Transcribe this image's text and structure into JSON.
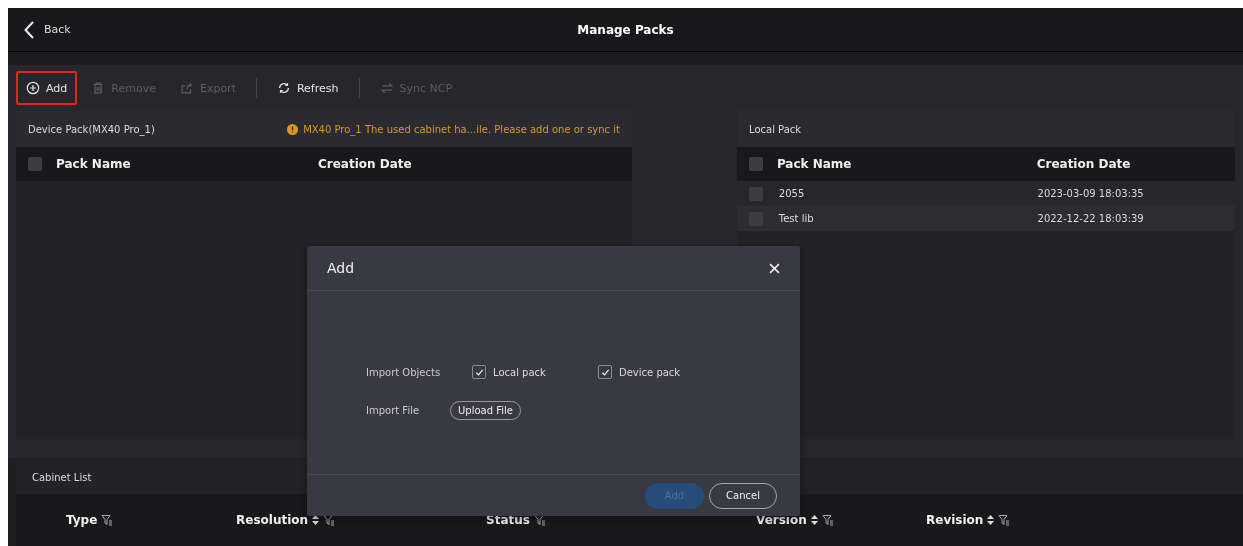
{
  "header": {
    "back": "Back",
    "title": "Manage Packs"
  },
  "toolbar": [
    {
      "kind": "add",
      "label": "Add",
      "disabled": false,
      "highlighted": true
    },
    {
      "kind": "remove",
      "label": "Remove",
      "disabled": true,
      "highlighted": false
    },
    {
      "kind": "export",
      "label": "Export",
      "disabled": true,
      "highlighted": false
    },
    {
      "kind": "refresh",
      "label": "Refresh",
      "disabled": false,
      "highlighted": false
    },
    {
      "kind": "sync",
      "label": "Sync NCP",
      "disabled": true,
      "highlighted": false
    }
  ],
  "device_pack": {
    "title": "Device Pack(MX40 Pro_1)",
    "warning": "MX40 Pro_1 The used cabinet ha...ile. Please add one or sync it",
    "select_all": false,
    "columns": [
      "Pack Name",
      "Creation Date"
    ]
  },
  "local_pack": {
    "title": "Local Pack",
    "select_all": false,
    "columns": [
      "Pack Name",
      "Creation Date"
    ],
    "rows": [
      {
        "name": "2055",
        "date": "2023-03-09 18:03:35",
        "checked": false
      },
      {
        "name": "Test lib",
        "date": "2022-12-22 18:03:39",
        "checked": false
      }
    ]
  },
  "cabinet_list": {
    "title": "Cabinet List",
    "columns": [
      {
        "label": "Type",
        "sortable": false
      },
      {
        "label": "Resolution",
        "sortable": true
      },
      {
        "label": "Status",
        "sortable": false
      },
      {
        "label": "Version",
        "sortable": true
      },
      {
        "label": "Revision",
        "sortable": true
      }
    ]
  },
  "dialog": {
    "title": "Add",
    "import_objects_label": "Import Objects",
    "options": [
      {
        "label": "Local pack",
        "checked": true
      },
      {
        "label": "Device pack",
        "checked": true
      }
    ],
    "import_file_label": "Import File",
    "upload_button": "Upload File",
    "buttons": [
      {
        "label": "Add",
        "kind": "primary",
        "disabled": true
      },
      {
        "label": "Cancel",
        "kind": "secondary",
        "disabled": false
      }
    ]
  }
}
